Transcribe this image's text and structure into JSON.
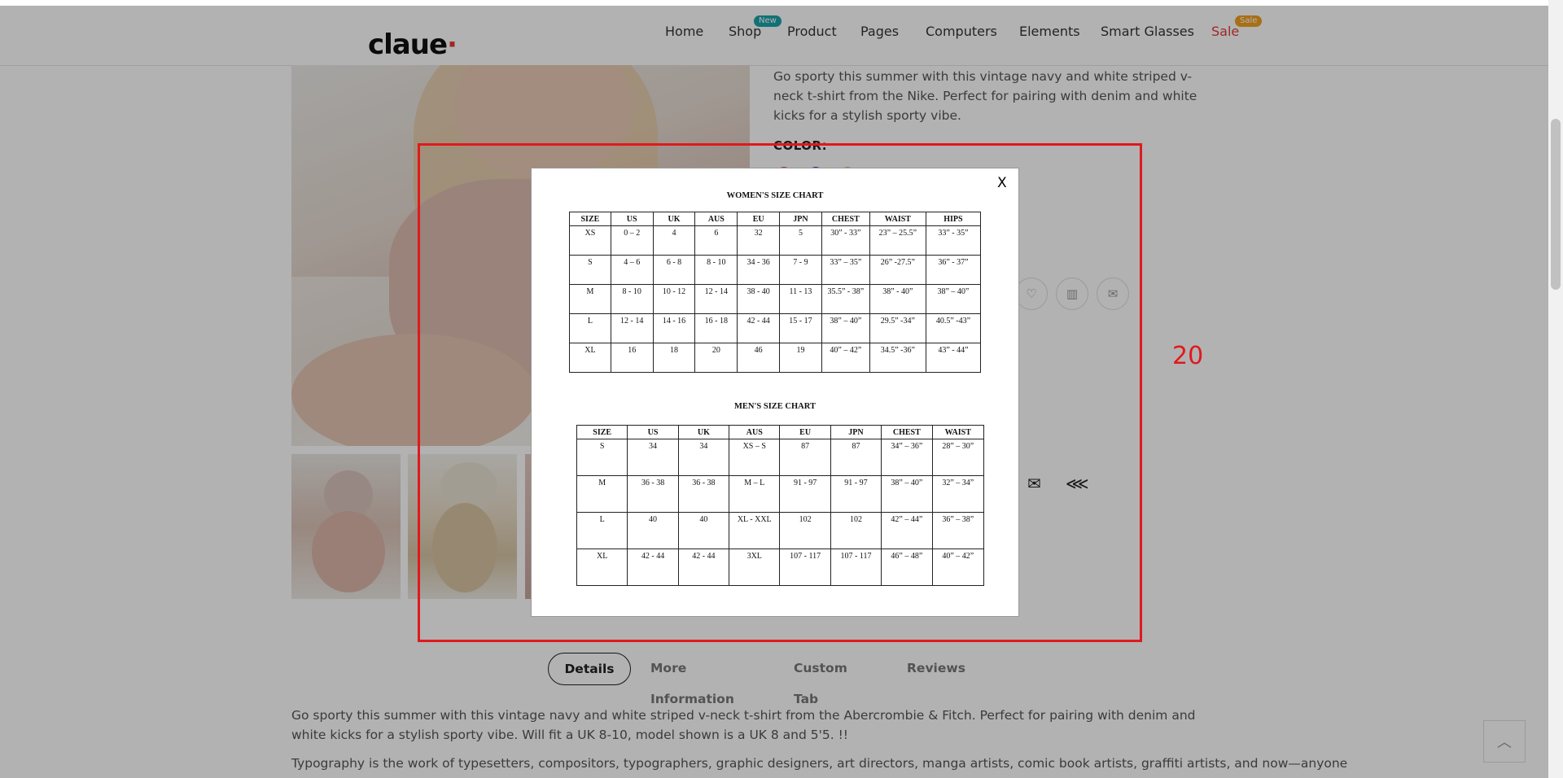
{
  "header": {
    "logo": "claue",
    "nav": [
      {
        "label": "Home",
        "badge": ""
      },
      {
        "label": "Shop",
        "badge": "New"
      },
      {
        "label": "Product",
        "badge": ""
      },
      {
        "label": "Pages",
        "badge": ""
      },
      {
        "label": "Computers",
        "badge": ""
      },
      {
        "label": "Elements",
        "badge": ""
      },
      {
        "label": "Smart Glasses",
        "badge": ""
      },
      {
        "label": "Sale",
        "badge": "Sale"
      }
    ],
    "colors": {
      "new_badge": "#1aa3a8",
      "sale_badge": "#f0a020",
      "sale_text": "#e53935"
    }
  },
  "product": {
    "short_description": "Go sporty this summer with this vintage navy and white striped v-neck t-shirt from the Nike. Perfect for pairing with denim and white kicks for a stylish sporty vibe.",
    "color_label": "COLOR:",
    "swatches": [
      "#cc3aa8",
      "#6a1fb5",
      "#c9c06a"
    ]
  },
  "modal": {
    "close_label": "X",
    "women": {
      "title": "WOMEN'S SIZE CHART",
      "headers": [
        "SIZE",
        "US",
        "UK",
        "AUS",
        "EU",
        "JPN",
        "CHEST",
        "WAIST",
        "HIPS"
      ],
      "rows": [
        [
          "XS",
          "0 – 2",
          "4",
          "6",
          "32",
          "5",
          "30” - 33”",
          "23” – 25.5”",
          "33” - 35”"
        ],
        [
          "S",
          "4 – 6",
          "6 - 8",
          "8 - 10",
          "34 - 36",
          "7 - 9",
          "33” – 35”",
          "26” -27.5”",
          "36” - 37”"
        ],
        [
          "M",
          "8 - 10",
          "10 - 12",
          "12 - 14",
          "38 - 40",
          "11 - 13",
          "35.5” - 38”",
          "38” - 40”",
          "38” – 40”"
        ],
        [
          "L",
          "12 - 14",
          "14 - 16",
          "16 - 18",
          "42 - 44",
          "15 - 17",
          "38” – 40”",
          "29.5” -34”",
          "40.5” -43”"
        ],
        [
          "XL",
          "16",
          "18",
          "20",
          "46",
          "19",
          "40” – 42”",
          "34.5” -36”",
          "43” - 44”"
        ]
      ]
    },
    "men": {
      "title": "MEN'S SIZE CHART",
      "headers": [
        "SIZE",
        "US",
        "UK",
        "AUS",
        "EU",
        "JPN",
        "CHEST",
        "WAIST"
      ],
      "rows": [
        [
          "S",
          "34",
          "34",
          "XS – S",
          "87",
          "87",
          "34” – 36”",
          "28” – 30”"
        ],
        [
          "M",
          "36 - 38",
          "36 - 38",
          "M – L",
          "91 - 97",
          "91 - 97",
          "38” – 40”",
          "32” – 34”"
        ],
        [
          "L",
          "40",
          "40",
          "XL - XXL",
          "102",
          "102",
          "42” – 44”",
          "36” – 38”"
        ],
        [
          "XL",
          "42 - 44",
          "42 - 44",
          "3XL",
          "107 - 117",
          "107 - 117",
          "46” – 48”",
          "40” – 42”"
        ]
      ]
    }
  },
  "annotation": {
    "label": "20",
    "color": "#e0191d"
  },
  "tabs": [
    "Details",
    "More Information",
    "Custom Tab",
    "Reviews"
  ],
  "details": {
    "paragraph1": "Go sporty this summer with this vintage navy and white striped v-neck t-shirt from the Abercrombie & Fitch. Perfect for pairing with denim and white kicks for a stylish sporty vibe. Will fit a UK 8-10, model shown is a UK 8 and 5'5. !!",
    "paragraph2": "Typography is the work of typesetters, compositors, typographers, graphic designers, art directors, manga artists, comic book artists, graffiti artists, and now—anyone"
  },
  "icons": {
    "wishlist": "heart-icon",
    "compare": "bar-chart-icon",
    "email": "envelope-icon",
    "share": "share-icon",
    "back_to_top": "chevron-up-icon"
  }
}
